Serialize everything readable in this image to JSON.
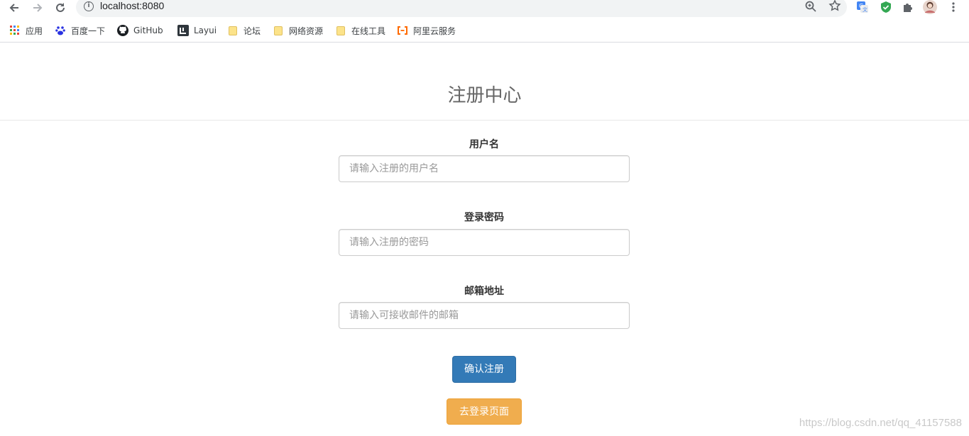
{
  "browser": {
    "url": "localhost:8080",
    "icons": [
      "back-icon",
      "forward-icon",
      "reload-icon",
      "info-icon",
      "zoom-icon",
      "star-icon",
      "translate-icon",
      "shield-icon",
      "puzzle-icon",
      "avatar",
      "menu-icon"
    ],
    "bookmarks": [
      {
        "label": "应用",
        "icon": "apps-grid-icon"
      },
      {
        "label": "百度一下",
        "icon": "baidu-paw-icon"
      },
      {
        "label": "GitHub",
        "icon": "github-icon"
      },
      {
        "label": "Layui",
        "icon": "layui-icon"
      },
      {
        "label": "论坛",
        "icon": "folder-icon"
      },
      {
        "label": "网络资源",
        "icon": "folder-icon"
      },
      {
        "label": "在线工具",
        "icon": "folder-icon"
      },
      {
        "label": "阿里云服务",
        "icon": "aliyun-icon"
      }
    ]
  },
  "page": {
    "title": "注册中心",
    "username_label": "用户名",
    "username_placeholder": "请输入注册的用户名",
    "password_label": "登录密码",
    "password_placeholder": "请输入注册的密码",
    "email_label": "邮箱地址",
    "email_placeholder": "请输入可接收邮件的邮箱",
    "submit_label": "确认注册",
    "login_label": "去登录页面"
  },
  "watermark": "https://blog.csdn.net/qq_41157588",
  "colors": {
    "primary": "#337ab7",
    "warning": "#f0ad4e",
    "title": "#666666"
  }
}
